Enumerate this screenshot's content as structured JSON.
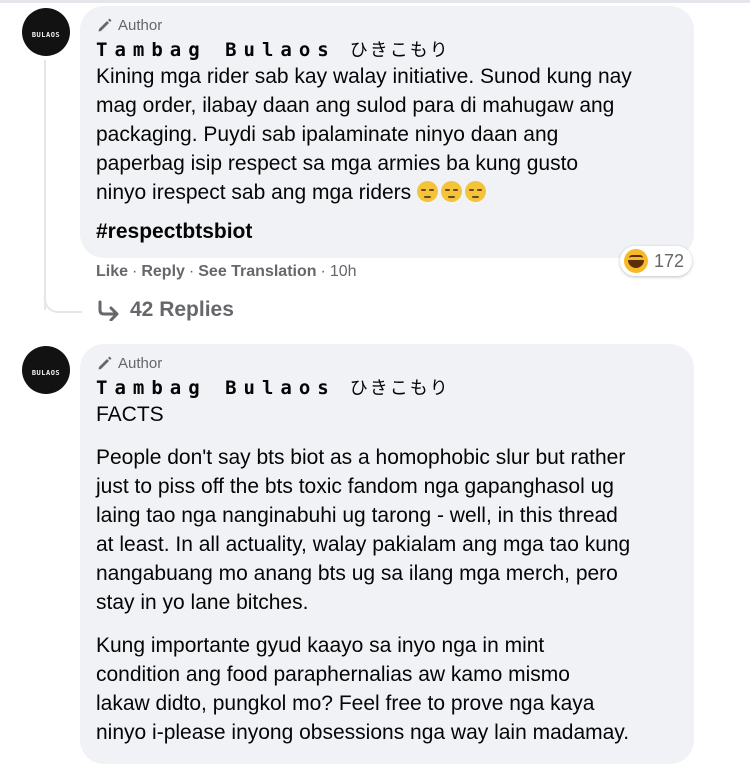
{
  "comments": [
    {
      "badge": "Author",
      "name": "Tambag Bulaos",
      "name_jp": "ひきこもり",
      "avatar_text": "BULAOS",
      "lines": [
        "Kining mga rider sab kay walay initiative. Sunod kung nay",
        "mag order, ilabay daan ang sulod para di mahugaw ang",
        "packaging. Puydi sab ipalaminate ninyo daan ang",
        "paperbag isip respect sa mga armies ba kung gusto",
        "ninyo irespect sab ang mga riders"
      ],
      "hashtag": "#respectbtsbiot",
      "reaction_count": "172",
      "actions": {
        "like": "Like",
        "reply": "Reply",
        "translate": "See Translation",
        "time": "10h"
      },
      "replies": "42 Replies"
    },
    {
      "badge": "Author",
      "name": "Tambag Bulaos",
      "name_jp": "ひきこもり",
      "avatar_text": "BULAOS",
      "lead": "FACTS",
      "para1": [
        "People don't say bts biot as a homophobic slur but rather",
        "just to piss off the bts toxic fandom nga gapanghasol ug",
        "laing tao nga nanginabuhi ug tarong - well, in this thread",
        "at least. In all actuality, walay pakialam ang mga tao kung",
        "nangabuang mo anang bts ug sa ilang mga merch, pero",
        "stay in yo lane bitches."
      ],
      "para2": [
        "Kung importante gyud kaayo sa inyo nga in mint",
        "condition ang food paraphernalias aw kamo mismo",
        "lakaw didto, pungkol mo? Feel free to prove nga kaya",
        "ninyo i-please inyong obsessions nga way lain madamay."
      ]
    }
  ]
}
